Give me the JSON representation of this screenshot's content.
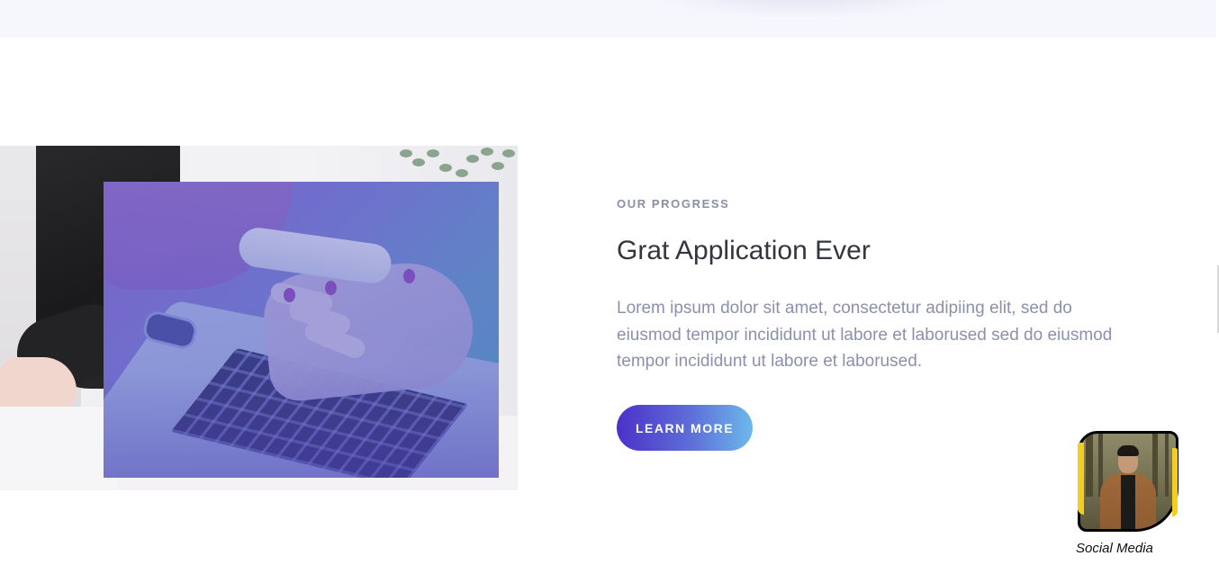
{
  "section": {
    "eyebrow": "OUR PROGRESS",
    "title": "Grat Application Ever",
    "body": "Lorem ipsum dolor sit amet, consectetur adipiing elit, sed do eiusmod tempor incididunt ut labore et laborused sed do eiusmod tempor incididunt ut labore et laborused.",
    "cta_label": "LEARN MORE"
  },
  "social_widget": {
    "label": "Social Media"
  },
  "colors": {
    "accent_start": "#4b31c8",
    "accent_end": "#6cb8ec",
    "heading": "#33363f",
    "muted_text": "#8c90ab",
    "eyebrow": "#8a8fa8",
    "avatar_ring": "#f2cf1c"
  },
  "icons": {
    "image_collage": "laptop-phone-photo",
    "avatar": "profile-photo"
  }
}
